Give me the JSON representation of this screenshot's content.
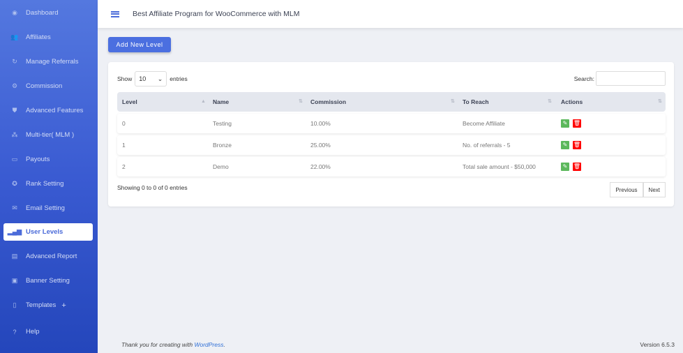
{
  "sidebar": {
    "items": [
      {
        "label": "Dashboard",
        "icon": "eye-icon"
      },
      {
        "label": "Affiliates",
        "icon": "users-icon"
      },
      {
        "label": "Manage Referrals",
        "icon": "referral-icon"
      },
      {
        "label": "Commission",
        "icon": "gear-icon"
      },
      {
        "label": "Advanced Features",
        "icon": "shield-plus-icon"
      },
      {
        "label": "Multi-tier( MLM )",
        "icon": "network-icon"
      },
      {
        "label": "Payouts",
        "icon": "money-icon"
      },
      {
        "label": "Rank Setting",
        "icon": "star-icon"
      },
      {
        "label": "Email Setting",
        "icon": "envelope-icon"
      },
      {
        "label": "User Levels",
        "icon": "bar-chart-icon",
        "active": true
      },
      {
        "label": "Advanced Report",
        "icon": "report-icon"
      },
      {
        "label": "Banner Setting",
        "icon": "image-icon"
      },
      {
        "label": "Templates",
        "icon": "template-icon",
        "expand": "+"
      },
      {
        "label": "Help",
        "icon": "question-icon"
      }
    ]
  },
  "header": {
    "title": "Best Affiliate Program for WooCommerce with MLM"
  },
  "add_button": "Add New Level",
  "table": {
    "show_label": "Show",
    "entries_value": "10",
    "entries_label": "entries",
    "search_label": "Search:",
    "search_value": "",
    "columns": [
      "Level",
      "Name",
      "Commission",
      "To Reach",
      "Actions"
    ],
    "rows": [
      {
        "level": "0",
        "name": "Testing",
        "commission": "10.00%",
        "to_reach": "Become Affiliate"
      },
      {
        "level": "1",
        "name": "Bronze",
        "commission": "25.00%",
        "to_reach": "No. of referrals - 5"
      },
      {
        "level": "2",
        "name": "Demo",
        "commission": "22.00%",
        "to_reach": "Total sale amount - $50,000"
      }
    ],
    "info": "Showing 0 to 0 of 0 entries",
    "previous": "Previous",
    "next": "Next"
  },
  "footer": {
    "text": "Thank you for creating with",
    "link": "WordPress",
    "period": ".",
    "version": "Version 6.5.3"
  },
  "colors": {
    "accent": "#4b6fe0",
    "edit": "#5cb85c",
    "delete": "#ff0000"
  }
}
